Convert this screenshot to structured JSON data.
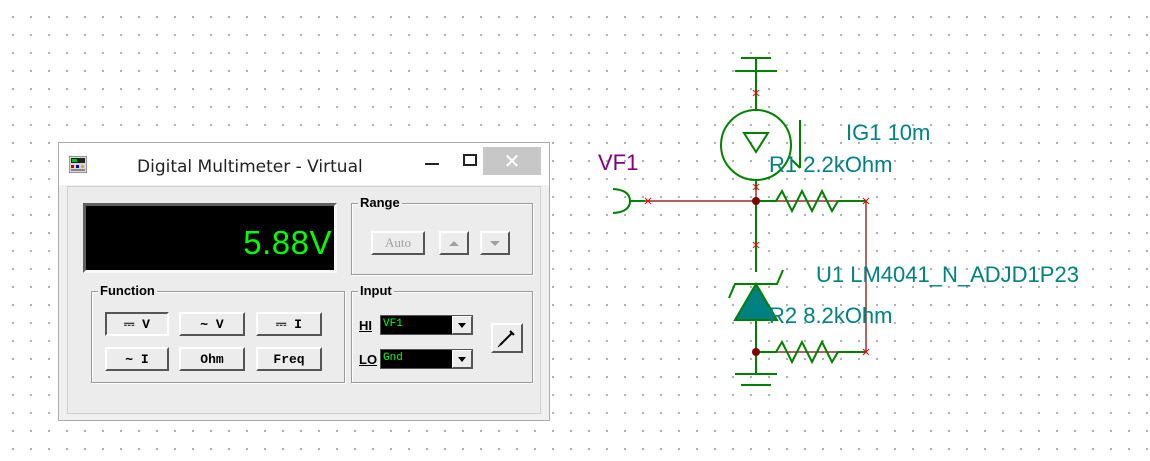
{
  "window": {
    "title": "Digital Multimeter - Virtual",
    "controls": {
      "minimize": "minimize",
      "maximize": "maximize",
      "close": "✕"
    }
  },
  "display": {
    "value": "5.88V"
  },
  "range": {
    "label": "Range",
    "auto_label": "Auto"
  },
  "function": {
    "label": "Function",
    "buttons": [
      "⎓ V",
      "∼ V",
      "⎓ I",
      "∼ I",
      "Ohm",
      "Freq"
    ]
  },
  "input": {
    "label": "Input",
    "hi_label": "HI",
    "hi_value": "VF1",
    "lo_label": "LO",
    "lo_value": "Gnd"
  },
  "schematic": {
    "vf1_label": "VF1",
    "ig1_label": "IG1 10m",
    "r1_label": "R1 2.2kOhm",
    "u1_label": "U1 LM4041_N_ADJD1P23",
    "r2_label": "R2 8.2kOhm",
    "colors": {
      "wire": "#800000",
      "component": "#008000",
      "label": "#008080",
      "vf_label": "#800080",
      "node": "#800000",
      "diode_fill": "#008080",
      "pin_mark": "#ff0000"
    }
  },
  "icons": [
    "multimeter-app-icon",
    "probe-icon",
    "up-arrow-icon",
    "down-arrow-icon",
    "dropdown-arrow-icon"
  ]
}
